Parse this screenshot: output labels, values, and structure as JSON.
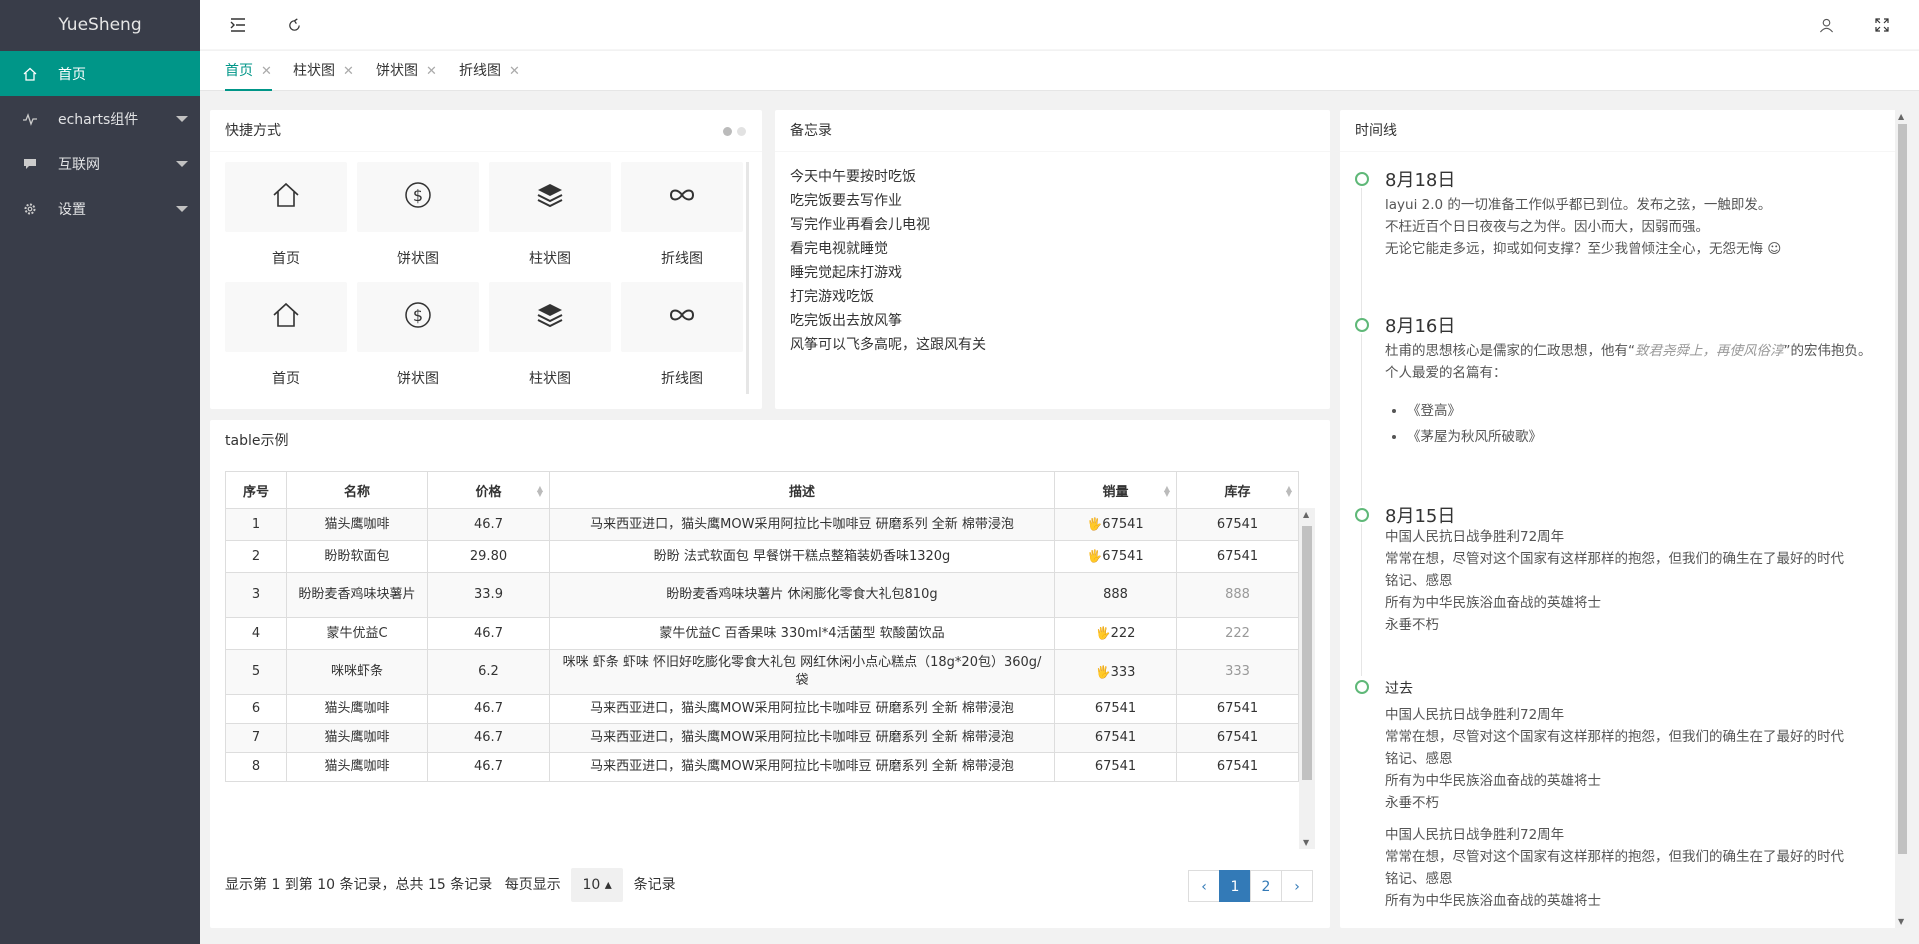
{
  "app": {
    "title": "YueSheng"
  },
  "sidebar": {
    "items": [
      {
        "label": "首页",
        "icon": "home-icon"
      },
      {
        "label": "echarts组件",
        "icon": "chart-icon"
      },
      {
        "label": "互联网",
        "icon": "chat-icon"
      },
      {
        "label": "设置",
        "icon": "gear-icon"
      }
    ]
  },
  "header": {
    "icons": [
      "menu-toggle-icon",
      "refresh-icon",
      "user-icon",
      "fullscreen-icon"
    ]
  },
  "tabs": [
    {
      "label": "首页",
      "active": true
    },
    {
      "label": "柱状图",
      "active": false
    },
    {
      "label": "饼状图",
      "active": false
    },
    {
      "label": "折线图",
      "active": false
    }
  ],
  "shortcuts": {
    "title": "快捷方式",
    "items": [
      {
        "label": "首页",
        "icon": "home-icon"
      },
      {
        "label": "饼状图",
        "icon": "dollar-icon"
      },
      {
        "label": "柱状图",
        "icon": "layers-icon"
      },
      {
        "label": "折线图",
        "icon": "infinity-icon"
      },
      {
        "label": "首页",
        "icon": "home-icon"
      },
      {
        "label": "饼状图",
        "icon": "dollar-icon"
      },
      {
        "label": "柱状图",
        "icon": "layers-icon"
      },
      {
        "label": "折线图",
        "icon": "infinity-icon"
      }
    ]
  },
  "memo": {
    "title": "备忘录",
    "items": [
      "今天中午要按时吃饭",
      "吃完饭要去写作业",
      "写完作业再看会儿电视",
      "看完电视就睡觉",
      "睡完觉起床打游戏",
      "打完游戏吃饭",
      "吃完饭出去放风筝",
      "风筝可以飞多高呢，这跟风有关"
    ]
  },
  "timeline": {
    "title": "时间线",
    "items": [
      {
        "title": "8月18日",
        "lines": [
          "layui 2.0 的一切准备工作似乎都已到位。发布之弦，一触即发。",
          "不枉近百个日日夜夜与之为伴。因小而大，因弱而强。",
          "无论它能走多远，抑或如何支撑？至少我曾倾注全心，无怨无悔 ☺"
        ]
      },
      {
        "title": "8月16日",
        "line_a": "杜甫的思想核心是儒家的仁政思想，他有“",
        "quote": "致君尧舜上，再使风俗淳",
        "line_b": "”的宏伟抱负。个人最爱的名篇有：",
        "bullets": [
          "《登高》",
          "《茅屋为秋风所破歌》"
        ]
      },
      {
        "title": "8月15日",
        "lines": [
          "中国人民抗日战争胜利72周年",
          "常常在想，尽管对这个国家有这样那样的抱怨，但我们的确生在了最好的时代",
          "铭记、感恩",
          "所有为中华民族浴血奋战的英雄将士",
          "永垂不朽"
        ]
      },
      {
        "title": "过去",
        "lines": [
          "中国人民抗日战争胜利72周年",
          "常常在想，尽管对这个国家有这样那样的抱怨，但我们的确生在了最好的时代",
          "铭记、感恩",
          "所有为中华民族浴血奋战的英雄将士",
          "永垂不朽"
        ],
        "lines2": [
          "中国人民抗日战争胜利72周年",
          "常常在想，尽管对这个国家有这样那样的抱怨，但我们的确生在了最好的时代",
          "铭记、感恩",
          "所有为中华民族浴血奋战的英雄将士"
        ]
      }
    ]
  },
  "table": {
    "title": "table示例",
    "headers": [
      "序号",
      "名称",
      "价格",
      "描述",
      "销量",
      "库存"
    ],
    "rows": [
      {
        "no": "1",
        "name": "猫头鹰咖啡",
        "price": "46.7",
        "desc": "马来西亚进口，猫头鹰MOW采用阿拉比卡咖啡豆 研磨系列 全新 棉带浸泡",
        "sales": "67541",
        "hot": true,
        "stock": "67541",
        "muted": false
      },
      {
        "no": "2",
        "name": "盼盼软面包",
        "price": "29.80",
        "desc": "盼盼 法式软面包 早餐饼干糕点整箱装奶香味1320g",
        "sales": "67541",
        "hot": true,
        "stock": "67541",
        "muted": false
      },
      {
        "no": "3",
        "name": "盼盼麦香鸡味块薯片",
        "price": "33.9",
        "desc": "盼盼麦香鸡味块薯片 休闲膨化零食大礼包810g",
        "sales": "888",
        "hot": false,
        "stock": "888",
        "muted": true
      },
      {
        "no": "4",
        "name": "蒙牛优益C",
        "price": "46.7",
        "desc": "蒙牛优益C 百香果味 330ml*4活菌型 软酸菌饮品",
        "sales": "222",
        "hot": true,
        "stock": "222",
        "muted": true
      },
      {
        "no": "5",
        "name": "咪咪虾条",
        "price": "6.2",
        "desc": "咪咪 虾条 虾味 怀旧好吃膨化零食大礼包 网红休闲小点心糕点（18g*20包）360g/袋",
        "sales": "333",
        "hot": true,
        "stock": "333",
        "muted": true
      },
      {
        "no": "6",
        "name": "猫头鹰咖啡",
        "price": "46.7",
        "desc": "马来西亚进口，猫头鹰MOW采用阿拉比卡咖啡豆 研磨系列 全新 棉带浸泡",
        "sales": "67541",
        "hot": false,
        "stock": "67541",
        "muted": false
      },
      {
        "no": "7",
        "name": "猫头鹰咖啡",
        "price": "46.7",
        "desc": "马来西亚进口，猫头鹰MOW采用阿拉比卡咖啡豆 研磨系列 全新 棉带浸泡",
        "sales": "67541",
        "hot": false,
        "stock": "67541",
        "muted": false
      },
      {
        "no": "8",
        "name": "猫头鹰咖啡",
        "price": "46.7",
        "desc": "马来西亚进口，猫头鹰MOW采用阿拉比卡咖啡豆 研磨系列 全新 棉带浸泡",
        "sales": "67541",
        "hot": false,
        "stock": "67541",
        "muted": false
      }
    ],
    "pager": {
      "info": "显示第 1 到第 10 条记录，总共 15 条记录",
      "per_page_prefix": "每页显示",
      "page_size": "10 ▴",
      "per_page_suffix": "条记录",
      "prev": "‹",
      "pages": [
        "1",
        "2"
      ],
      "next": "›"
    }
  },
  "colors": {
    "accent": "#009688",
    "sidebar_bg": "#393d49",
    "timeline_dot": "#5FB878",
    "hot_icon": "#f0a020",
    "pager_active": "#337ab7"
  }
}
